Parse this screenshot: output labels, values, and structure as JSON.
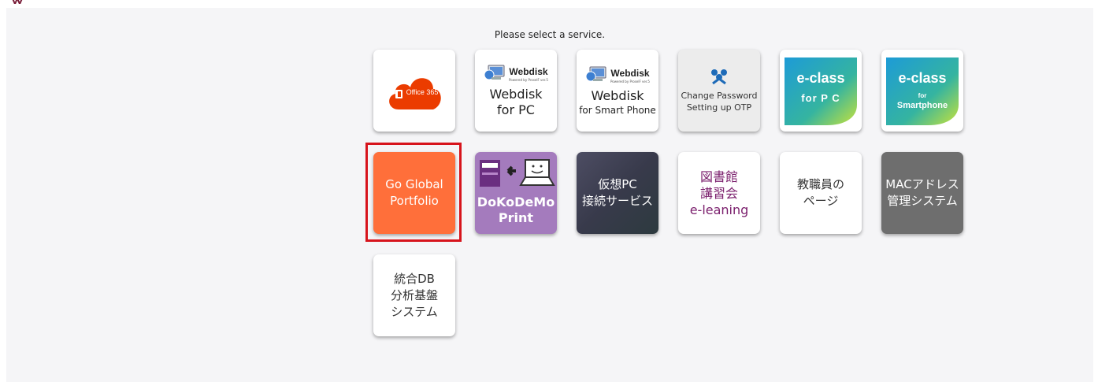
{
  "header": {
    "prompt": "Please select a service."
  },
  "tiles": {
    "office365": {
      "label": "Office 365",
      "color": "#eb3c00"
    },
    "webdisk_pc": {
      "logo": "Webdisk",
      "logo_sub": "Powered by ProselF ver.5",
      "line1": "Webdisk",
      "line2": "for PC"
    },
    "webdisk_sp": {
      "logo": "Webdisk",
      "logo_sub": "Powered by ProselF ver.5",
      "line1": "Webdisk",
      "line2": "for Smart Phone"
    },
    "change_password": {
      "line1": "Change Password",
      "line2": "Setting up OTP"
    },
    "eclass_pc": {
      "title": "e-class",
      "sub": "for P C"
    },
    "eclass_sp": {
      "title": "e-class",
      "sub1": "for",
      "sub2": "Smartphone"
    },
    "go_global": {
      "line1": "Go Global",
      "line2": "Portfolio",
      "color": "#ff6f3a"
    },
    "dokodemo": {
      "line1": "DoKoDeMo",
      "line2": "Print",
      "color": "#a47bbd"
    },
    "vpc": {
      "line1": "仮想PC",
      "line2": "接続サービス"
    },
    "library": {
      "line1": "図書館",
      "line2": "講習会",
      "line3": "e-leaning",
      "color": "#7a1e6c"
    },
    "faculty": {
      "line1": "教職員の",
      "line2": "ページ"
    },
    "mac": {
      "line1": "MACアドレス",
      "line2": "管理システム"
    },
    "db": {
      "line1": "統合DB",
      "line2": "分析基盤",
      "line3": "システム"
    }
  }
}
